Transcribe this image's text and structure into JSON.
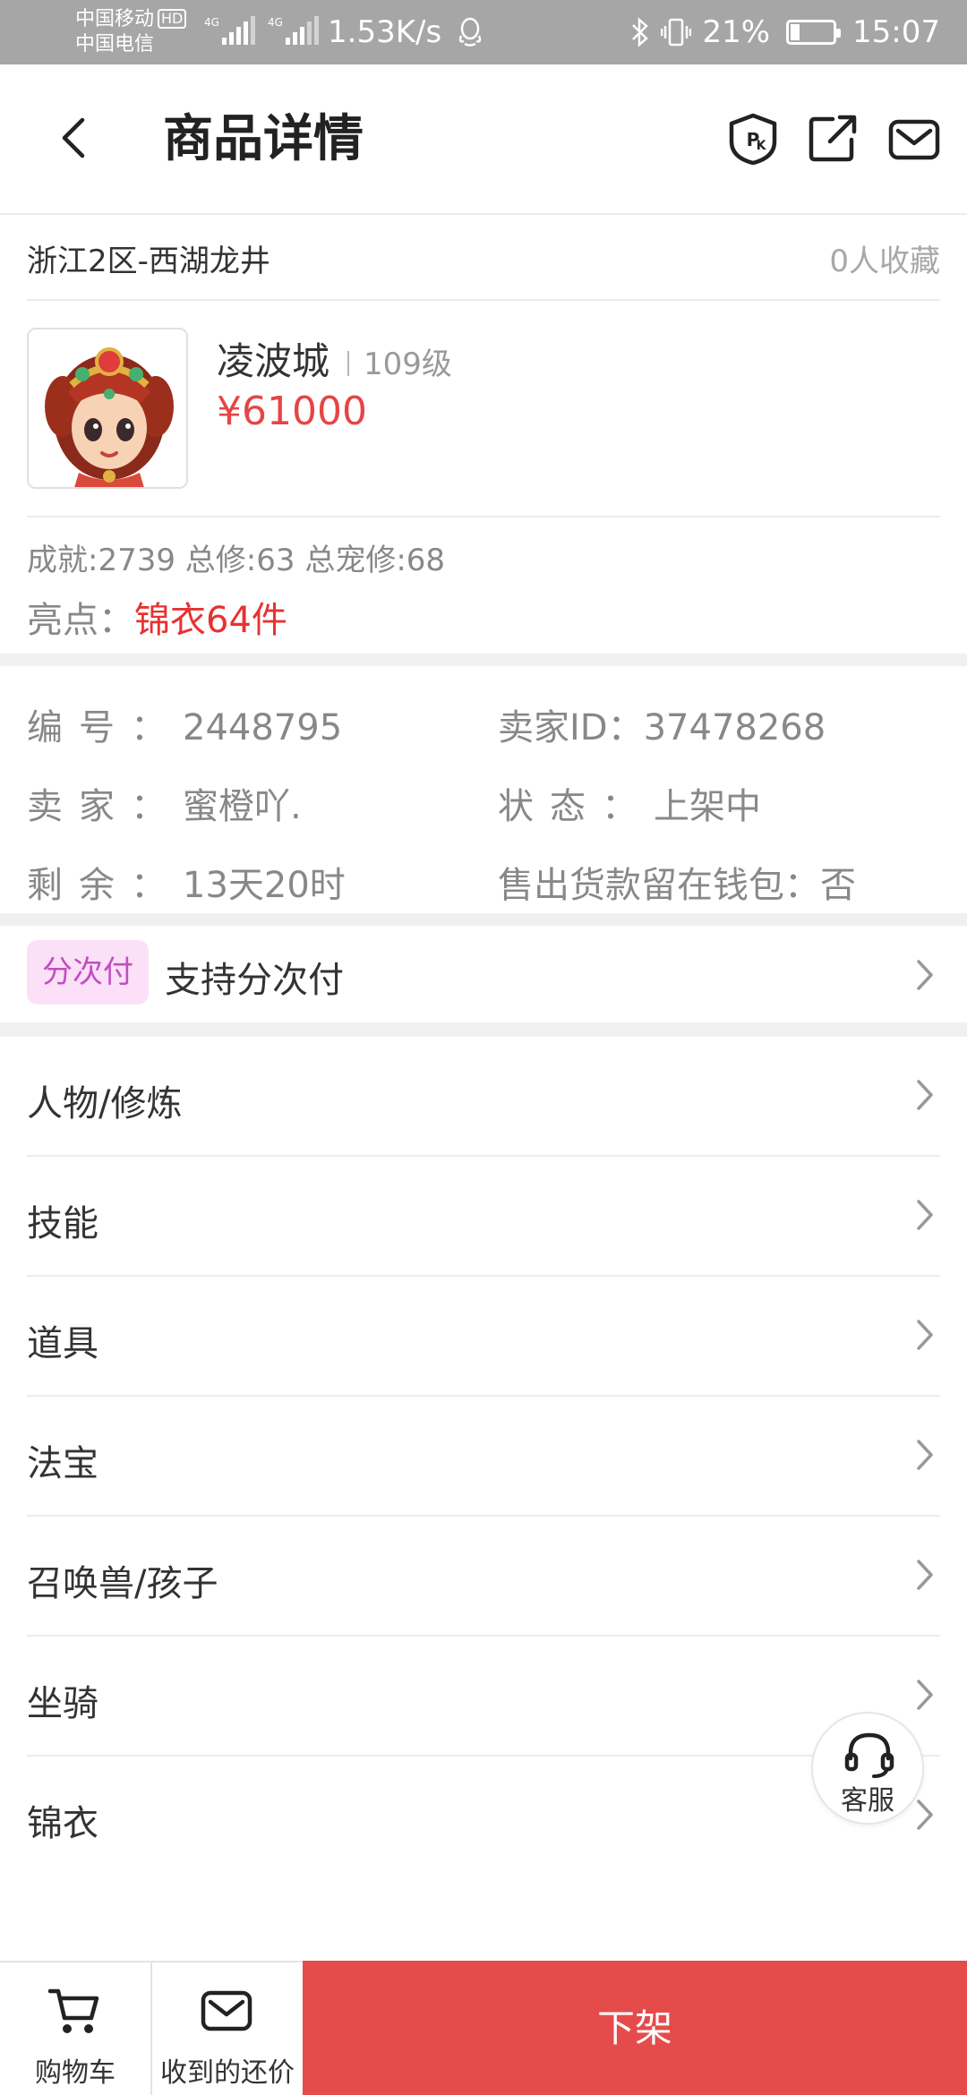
{
  "status_bar": {
    "carrier_1": "中国移动",
    "hd_badge": "HD",
    "carrier_2": "中国电信",
    "network_1": "4G",
    "network_2": "4G",
    "speed": "1.53K/s",
    "battery_percent": "21%",
    "battery_level": 0.21,
    "time": "15:07"
  },
  "header": {
    "title": "商品详情"
  },
  "listing": {
    "server": "浙江2区-西湖龙井",
    "favorites": "0人收藏",
    "name": "凌波城",
    "level": "109级",
    "price": "¥61000",
    "stats": "成就:2739 总修:63 总宠修:68",
    "highlight_label": "亮点：",
    "highlight_value": "锦衣64件"
  },
  "info": {
    "id_label": "编号：",
    "id_value": "2448795",
    "seller_id_label": "卖家ID：",
    "seller_id_value": "37478268",
    "seller_label": "卖家：",
    "seller_value": "蜜橙吖.",
    "status_label": "状态：",
    "status_value": "上架中",
    "remaining_label": "剩余：",
    "remaining_value": "13天20时",
    "wallet_label": "售出货款留在钱包：",
    "wallet_value": "否"
  },
  "installment": {
    "tag": "分次付",
    "text": "支持分次付"
  },
  "menu": {
    "items": [
      {
        "label": "人物/修炼"
      },
      {
        "label": "技能"
      },
      {
        "label": "道具"
      },
      {
        "label": "法宝"
      },
      {
        "label": "召唤兽/孩子"
      },
      {
        "label": "坐骑"
      },
      {
        "label": "锦衣"
      }
    ]
  },
  "customer_service": {
    "label": "客服"
  },
  "bottom_bar": {
    "cart_label": "购物车",
    "offers_label": "收到的还价",
    "delist_label": "下架"
  },
  "colors": {
    "accent_red": "#e64b4b",
    "price_red": "#e64545",
    "installment_tag_bg": "#fbe0f8",
    "installment_tag_text": "#c04fc1",
    "status_bar_bg": "#a6a6a6"
  },
  "icons": {
    "back": "chevron-left-icon",
    "pk": "pk-shield-icon",
    "share": "share-icon",
    "message": "mail-icon",
    "chevron": "chevron-right-icon",
    "cart": "cart-icon",
    "offers": "mail-icon",
    "customer_service": "headset-icon"
  }
}
